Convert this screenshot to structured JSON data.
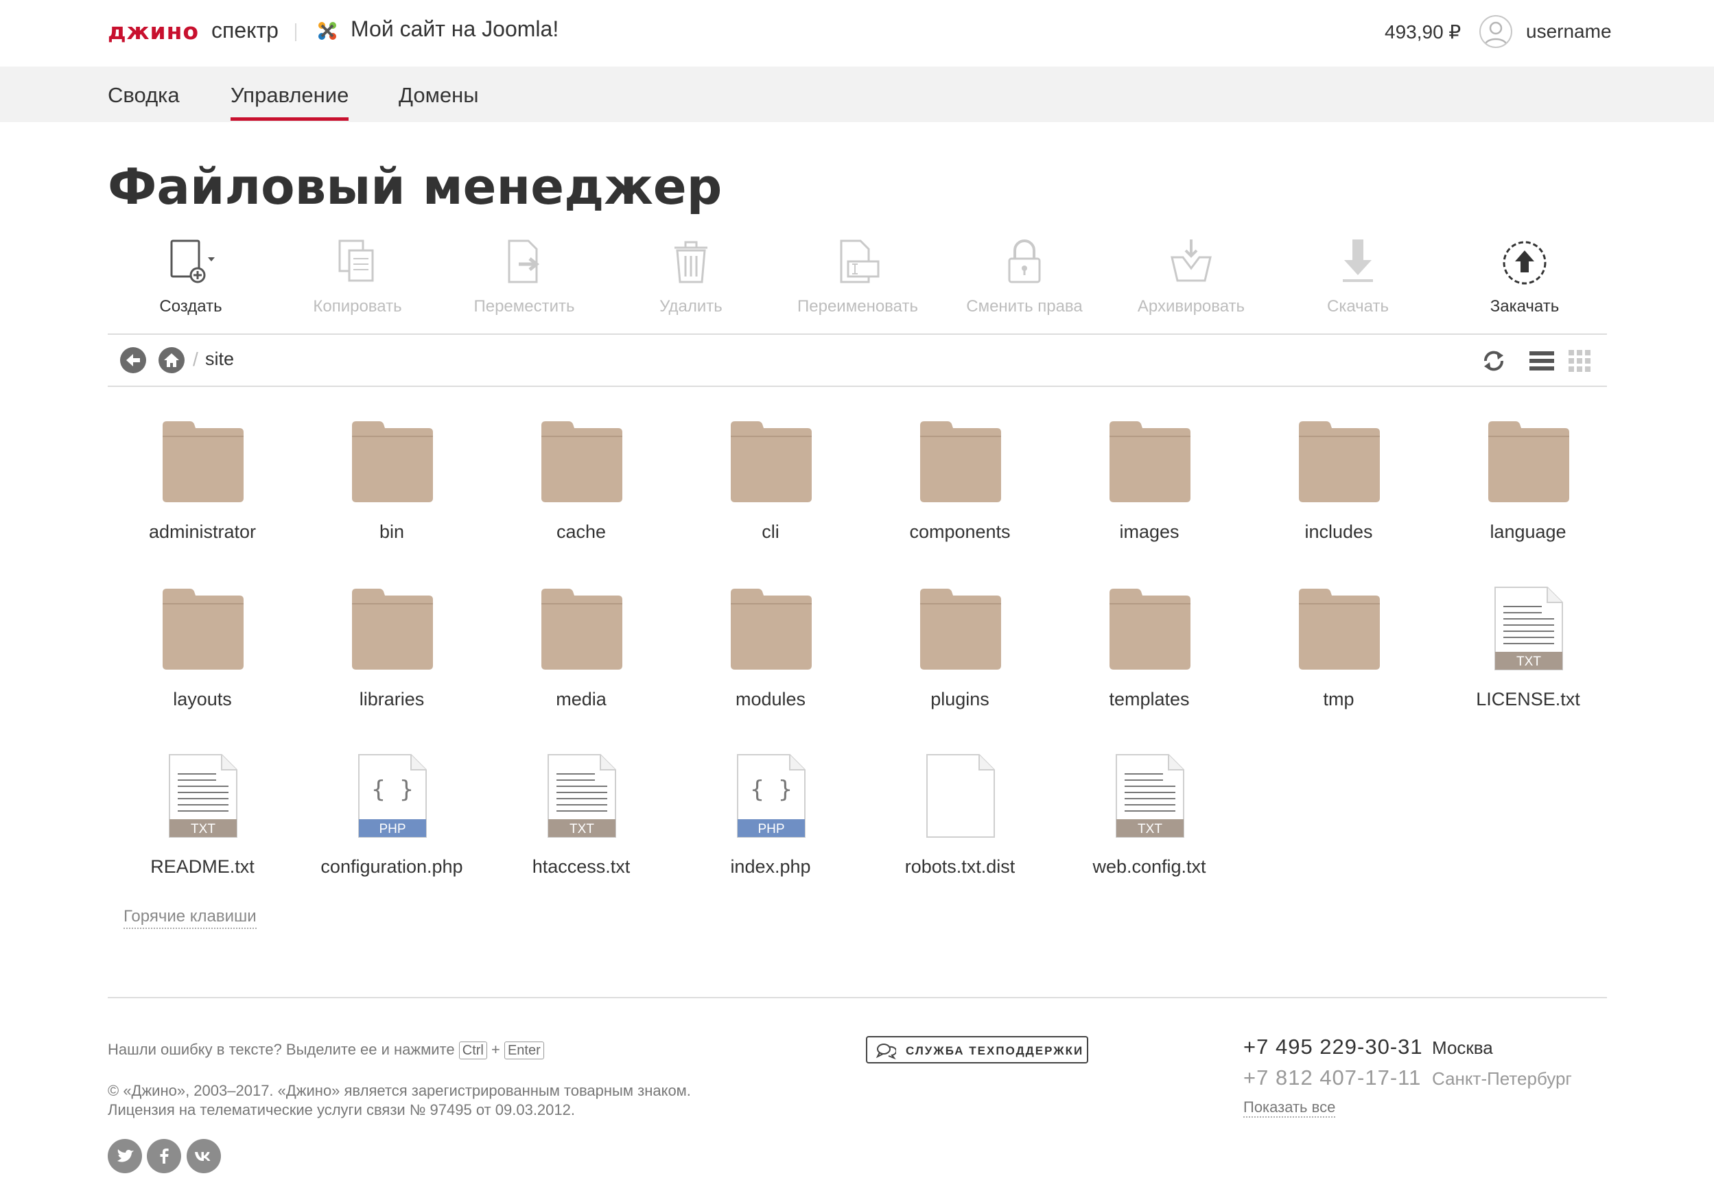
{
  "header": {
    "logo": "джино",
    "product": "спектр",
    "site_name": "Мой сайт на Joomla!",
    "balance": "493,90 ₽",
    "username": "username"
  },
  "nav": {
    "tabs": [
      {
        "label": "Сводка"
      },
      {
        "label": "Управление",
        "active": true
      },
      {
        "label": "Домены"
      }
    ]
  },
  "page": {
    "title": "Файловый менеджер"
  },
  "toolbar": {
    "items": [
      {
        "label": "Создать",
        "icon": "create-file-icon",
        "enabled": true
      },
      {
        "label": "Копировать",
        "icon": "copy-icon",
        "enabled": false
      },
      {
        "label": "Переместить",
        "icon": "move-icon",
        "enabled": false
      },
      {
        "label": "Удалить",
        "icon": "trash-icon",
        "enabled": false
      },
      {
        "label": "Переименовать",
        "icon": "rename-icon",
        "enabled": false
      },
      {
        "label": "Сменить права",
        "icon": "lock-icon",
        "enabled": false
      },
      {
        "label": "Архивировать",
        "icon": "archive-icon",
        "enabled": false
      },
      {
        "label": "Скачать",
        "icon": "download-icon",
        "enabled": false
      },
      {
        "label": "Закачать",
        "icon": "upload-icon",
        "enabled": true
      }
    ]
  },
  "path": {
    "separator": "/",
    "current": "site"
  },
  "files": [
    {
      "name": "administrator",
      "type": "folder"
    },
    {
      "name": "bin",
      "type": "folder"
    },
    {
      "name": "cache",
      "type": "folder"
    },
    {
      "name": "cli",
      "type": "folder"
    },
    {
      "name": "components",
      "type": "folder"
    },
    {
      "name": "images",
      "type": "folder"
    },
    {
      "name": "includes",
      "type": "folder"
    },
    {
      "name": "language",
      "type": "folder"
    },
    {
      "name": "layouts",
      "type": "folder"
    },
    {
      "name": "libraries",
      "type": "folder"
    },
    {
      "name": "media",
      "type": "folder"
    },
    {
      "name": "modules",
      "type": "folder"
    },
    {
      "name": "plugins",
      "type": "folder"
    },
    {
      "name": "templates",
      "type": "folder"
    },
    {
      "name": "tmp",
      "type": "folder"
    },
    {
      "name": "LICENSE.txt",
      "type": "txt",
      "badge": "TXT"
    },
    {
      "name": "README.txt",
      "type": "txt",
      "badge": "TXT"
    },
    {
      "name": "configuration.php",
      "type": "php",
      "badge": "PHP"
    },
    {
      "name": "htaccess.txt",
      "type": "txt",
      "badge": "TXT"
    },
    {
      "name": "index.php",
      "type": "php",
      "badge": "PHP"
    },
    {
      "name": "robots.txt.dist",
      "type": "blank"
    },
    {
      "name": "web.config.txt",
      "type": "txt",
      "badge": "TXT"
    }
  ],
  "hotkeys_label": "Горячие клавиши",
  "footer": {
    "error_text": "Нашли ошибку в тексте? Выделите ее и нажмите",
    "key_ctrl": "Ctrl",
    "key_plus": "+",
    "key_enter": "Enter",
    "copyright_line1": "© «Джино», 2003–2017. «Джино» является зарегистрированным товарным знаком.",
    "copyright_line2": "Лицензия на телематические услуги связи № 97495 от 09.03.2012.",
    "support_label": "СЛУЖБА ТЕХПОДДЕРЖКИ",
    "phones": [
      {
        "number": "+7 495 229-30-31",
        "city": "Москва"
      },
      {
        "number": "+7 812 407-17-11",
        "city": "Санкт-Петербург"
      }
    ],
    "show_all": "Показать все",
    "social": [
      "twitter-icon",
      "facebook-icon",
      "vk-icon"
    ]
  },
  "colors": {
    "brand": "#c8102e",
    "folder": "#c8b09a",
    "txt_badge": "#a89a8e",
    "php_badge": "#6f8fc4",
    "disabled": "#bdbdbd"
  }
}
